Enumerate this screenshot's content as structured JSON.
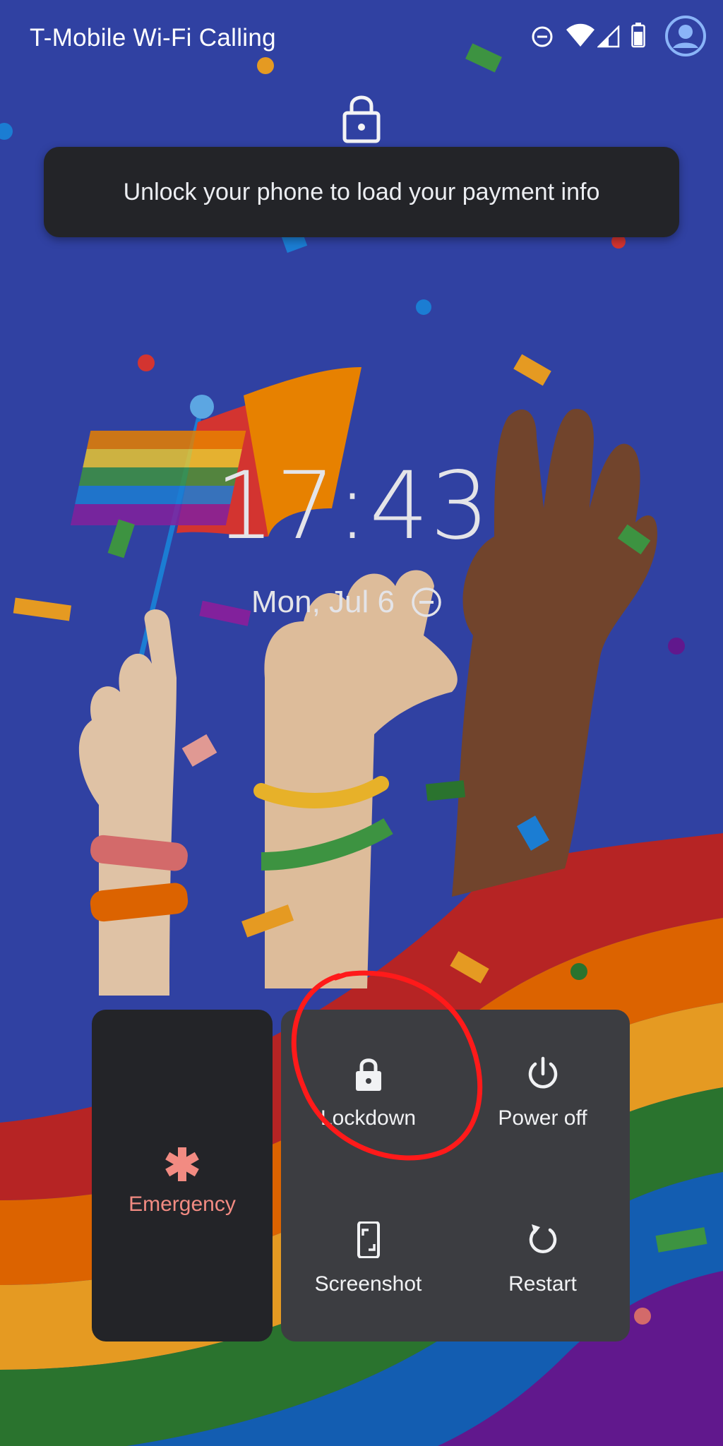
{
  "status_bar": {
    "carrier": "T-Mobile Wi-Fi Calling",
    "icons": [
      "do-not-disturb-icon",
      "wifi-icon",
      "cell-signal-icon",
      "battery-icon",
      "user-avatar-icon"
    ]
  },
  "toast": {
    "message": "Unlock your phone to load your payment info"
  },
  "lockscreen": {
    "time": "17:43",
    "date": "Mon, Jul 6"
  },
  "power_menu": {
    "emergency": {
      "label": "Emergency",
      "color": "#f28b82",
      "icon": "asterisk-icon"
    },
    "actions": [
      {
        "label": "Lockdown",
        "icon": "lock-icon"
      },
      {
        "label": "Power off",
        "icon": "power-icon"
      },
      {
        "label": "Screenshot",
        "icon": "screenshot-icon"
      },
      {
        "label": "Restart",
        "icon": "restart-icon"
      }
    ]
  },
  "colors": {
    "wallpaper": "#3547b0",
    "toast_bg": "#232428",
    "panel_bg": "#3c3d41",
    "annotation": "#ff1a1a"
  }
}
